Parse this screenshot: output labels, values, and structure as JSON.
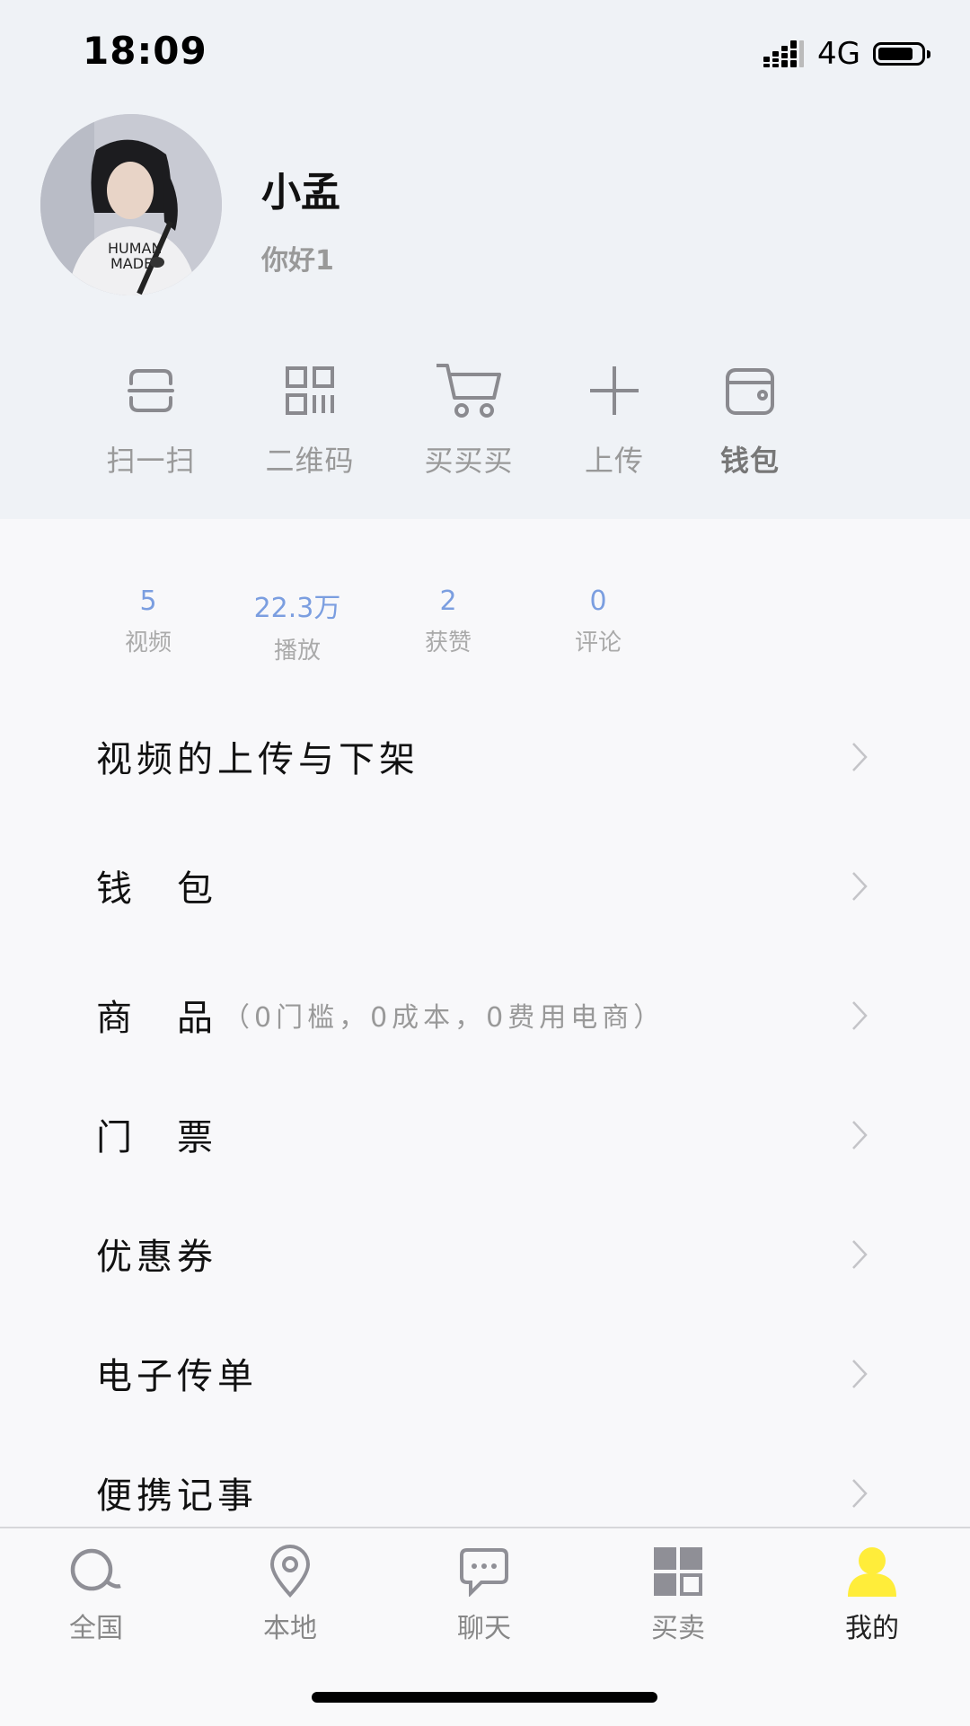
{
  "status_bar": {
    "time": "18:09",
    "network": "4G"
  },
  "profile": {
    "name": "小孟",
    "bio": "你好1"
  },
  "quick_actions": [
    {
      "label": "扫一扫",
      "icon": "scan-icon"
    },
    {
      "label": "二维码",
      "icon": "qrcode-icon"
    },
    {
      "label": "买买买",
      "icon": "cart-icon"
    },
    {
      "label": "上传",
      "icon": "plus-icon"
    },
    {
      "label": "钱包",
      "icon": "wallet-icon"
    }
  ],
  "stats": [
    {
      "value": "5",
      "label": "视频"
    },
    {
      "value": "22.3万",
      "label": "播放"
    },
    {
      "value": "2",
      "label": "获赞"
    },
    {
      "value": "0",
      "label": "评论"
    }
  ],
  "menu": [
    {
      "label": "视频的上传与下架",
      "sub": ""
    },
    {
      "label": "钱　包",
      "sub": ""
    },
    {
      "label": "商　品",
      "sub": "（0门槛，0成本，0费用电商）"
    },
    {
      "label": "门　票",
      "sub": ""
    },
    {
      "label": "优惠券",
      "sub": ""
    },
    {
      "label": "电子传单",
      "sub": ""
    },
    {
      "label": "便携记事",
      "sub": ""
    }
  ],
  "tabs": [
    {
      "label": "全国",
      "icon": "search-icon"
    },
    {
      "label": "本地",
      "icon": "location-pin-icon"
    },
    {
      "label": "聊天",
      "icon": "chat-bubble-icon"
    },
    {
      "label": "买卖",
      "icon": "grid-icon"
    },
    {
      "label": "我的",
      "icon": "user-icon",
      "active": true
    }
  ],
  "colors": {
    "accent_stat": "#7b9ee0",
    "active_tab": "#ffed3a",
    "header_bg": "#eff2f6"
  }
}
